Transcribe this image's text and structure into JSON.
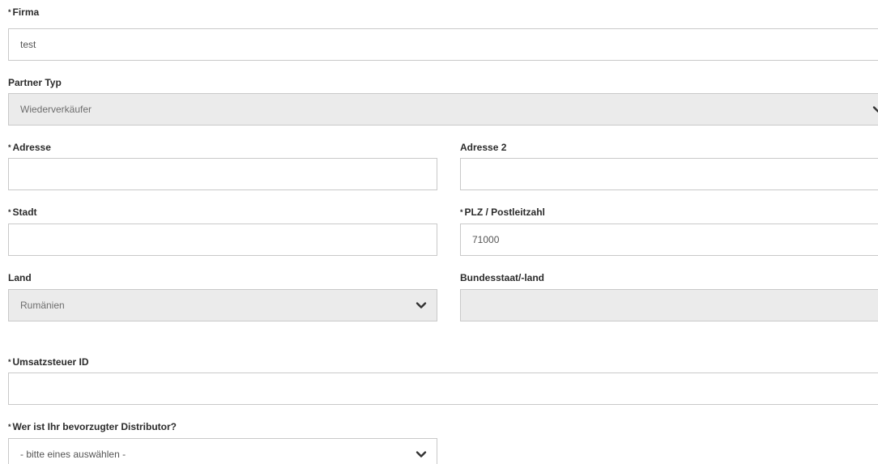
{
  "form": {
    "firma": {
      "label": "Firma",
      "required": true,
      "value": "test"
    },
    "partner_typ": {
      "label": "Partner Typ",
      "required": false,
      "selected": "Wiederverkäufer"
    },
    "adresse": {
      "label": "Adresse",
      "required": true,
      "value": ""
    },
    "adresse2": {
      "label": "Adresse 2",
      "required": false,
      "value": ""
    },
    "stadt": {
      "label": "Stadt",
      "required": true,
      "value": ""
    },
    "plz": {
      "label": "PLZ / Postleitzahl",
      "required": true,
      "value": "71000"
    },
    "land": {
      "label": "Land",
      "required": false,
      "selected": "Rumänien"
    },
    "bundesstaat": {
      "label": "Bundesstaat/-land",
      "required": false,
      "value": ""
    },
    "umsatzsteuer": {
      "label": "Umsatzsteuer ID",
      "required": true,
      "value": ""
    },
    "distributor": {
      "label": "Wer ist Ihr bevorzugter Distributor?",
      "required": true,
      "selected": "- bitte eines auswählen -"
    }
  },
  "required_marker": "*",
  "icons": {
    "dropdown": "chevron-down-icon"
  },
  "colors": {
    "border": "#c9c9c9",
    "disabled_bg": "#ebebeb",
    "label_text": "#2b2b2b",
    "value_text": "#6e6e6e"
  }
}
